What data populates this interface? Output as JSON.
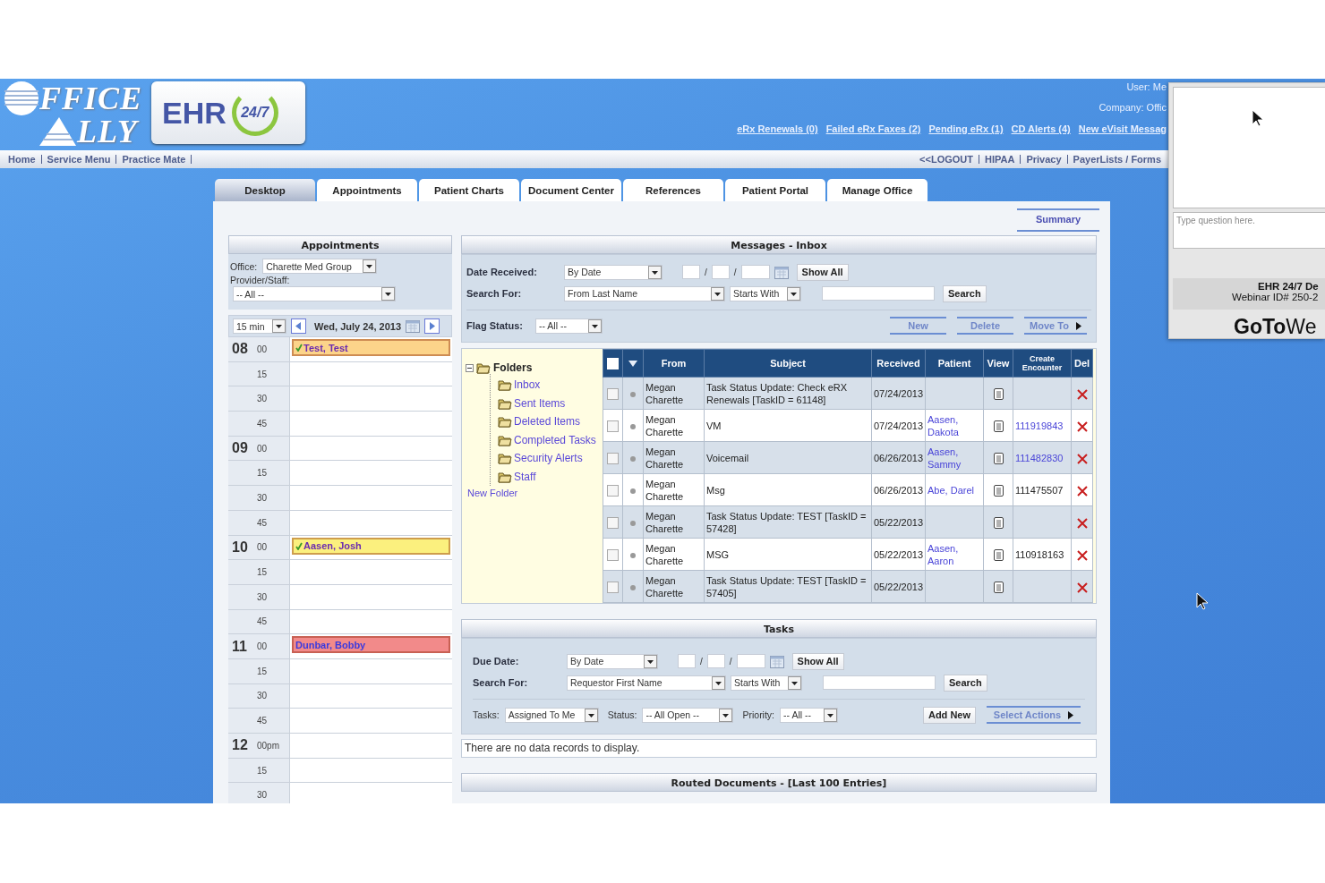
{
  "header": {
    "logo_line1": "FFICE",
    "logo_line2": "LLY",
    "badge_name": "EHR",
    "badge_tag": "24/7",
    "user": "User: Me",
    "company": "Company: Offic",
    "alert_links": [
      "eRx Renewals (0)",
      "Failed eRx Faxes (2)",
      "Pending eRx (1)",
      "CD Alerts (4)",
      "New eVisit Messag"
    ]
  },
  "nav": {
    "left": [
      "Home",
      "Service Menu",
      "Practice Mate"
    ],
    "right": [
      "<<LOGOUT",
      "HIPAA",
      "Privacy",
      "PayerLists / Forms"
    ]
  },
  "tabs": [
    {
      "label": "Desktop",
      "selected": true
    },
    {
      "label": "Appointments",
      "selected": false
    },
    {
      "label": "Patient Charts",
      "selected": false
    },
    {
      "label": "Document Center",
      "selected": false
    },
    {
      "label": "References",
      "selected": false
    },
    {
      "label": "Patient Portal",
      "selected": false
    },
    {
      "label": "Manage Office",
      "selected": false
    }
  ],
  "summary_link": "Summary",
  "appointments": {
    "title": "Appointments",
    "office_label": "Office:",
    "office": "Charette Med Group",
    "provider_label": "Provider/Staff:",
    "provider": "-- All --",
    "interval": "15 min",
    "date": "Wed, July 24, 2013",
    "hours": [
      {
        "hour": "08",
        "slots": [
          {
            "minute": "00",
            "appointment": {
              "patient": "Test, Test",
              "color": "#fcd48a",
              "confirmed": true
            }
          },
          {
            "minute": "15"
          },
          {
            "minute": "30"
          },
          {
            "minute": "45"
          }
        ]
      },
      {
        "hour": "09",
        "slots": [
          {
            "minute": "00"
          },
          {
            "minute": "15"
          },
          {
            "minute": "30"
          },
          {
            "minute": "45"
          }
        ]
      },
      {
        "hour": "10",
        "slots": [
          {
            "minute": "00",
            "appointment": {
              "patient": "Aasen, Josh",
              "color": "#fbf07e",
              "confirmed": true
            }
          },
          {
            "minute": "15"
          },
          {
            "minute": "30"
          },
          {
            "minute": "45"
          }
        ]
      },
      {
        "hour": "11",
        "slots": [
          {
            "minute": "00",
            "appointment": {
              "patient": "Dunbar, Bobby",
              "color": "#f28a8a",
              "confirmed": false
            }
          },
          {
            "minute": "15"
          },
          {
            "minute": "30"
          },
          {
            "minute": "45"
          }
        ]
      },
      {
        "hour": "12",
        "slots": [
          {
            "minute": "00pm"
          },
          {
            "minute": "15"
          },
          {
            "minute": "30"
          }
        ]
      }
    ]
  },
  "messages": {
    "title": "Messages - Inbox",
    "date_label": "Date Received:",
    "date_mode": "By Date",
    "date_separators": [
      "/",
      "/"
    ],
    "show_all": "Show All",
    "search_label": "Search For:",
    "search_field": "From Last Name",
    "search_match": "Starts With",
    "search_button": "Search",
    "flag_label": "Flag Status:",
    "flag_value": "-- All --",
    "actions": [
      "New",
      "Delete"
    ],
    "move_to": "Move To",
    "folders": {
      "label": "Folders",
      "expanded": true,
      "children": [
        "Inbox",
        "Sent Items",
        "Deleted Items",
        "Completed Tasks",
        "Security Alerts",
        "Staff"
      ]
    },
    "new_folder": "New Folder",
    "select_all_checked": false,
    "columns": [
      "From",
      "Subject",
      "Received",
      "Patient",
      "View",
      "Create Encounter",
      "Del"
    ],
    "rows": [
      {
        "checked": false,
        "from": "Megan Charette",
        "subject": "Task Status Update: Check eRX Renewals [TaskID = 61148]",
        "received": "07/24/2013"
      },
      {
        "checked": false,
        "from": "Megan Charette",
        "subject": "VM",
        "received": "07/24/2013",
        "patient": "Aasen, Dakota",
        "encounter": {
          "text": "111919843",
          "linked": true
        }
      },
      {
        "checked": false,
        "from": "Megan Charette",
        "subject": "Voicemail",
        "received": "06/26/2013",
        "patient": "Aasen, Sammy",
        "encounter": {
          "text": "111482830",
          "linked": true
        }
      },
      {
        "checked": false,
        "from": "Megan Charette",
        "subject": "Msg",
        "received": "06/26/2013",
        "patient": "Abe, Darel",
        "encounter": {
          "text": "111475507",
          "linked": false
        }
      },
      {
        "checked": false,
        "from": "Megan Charette",
        "subject": "Task Status Update: TEST [TaskID = 57428]",
        "received": "05/22/2013"
      },
      {
        "checked": false,
        "from": "Megan Charette",
        "subject": "MSG",
        "received": "05/22/2013",
        "patient": "Aasen, Aaron",
        "encounter": {
          "text": "110918163",
          "linked": false
        }
      },
      {
        "checked": false,
        "from": "Megan Charette",
        "subject": "Task Status Update: TEST [TaskID = 57405]",
        "received": "05/22/2013"
      }
    ]
  },
  "tasks": {
    "title": "Tasks",
    "date_label": "Due Date:",
    "date_mode": "By Date",
    "date_separators": [
      "/",
      "/"
    ],
    "show_all": "Show All",
    "search_label": "Search For:",
    "search_field": "Requestor First Name",
    "search_match": "Starts With",
    "search_button": "Search",
    "tasks_label": "Tasks:",
    "tasks_value": "Assigned To Me",
    "status_label": "Status:",
    "status_value": "-- All Open --",
    "priority_label": "Priority:",
    "priority_value": "-- All --",
    "add_new": "Add New",
    "select_actions": "Select Actions",
    "empty_message": "There are no data records to display."
  },
  "routed_documents": {
    "title": "Routed Documents - [Last 100 Entries]"
  },
  "webinar_panel": {
    "placeholder": "Type question here.",
    "title": "EHR 24/7 De",
    "webinar_id": "Webinar ID# 250-2",
    "brand_bold": "GoTo",
    "brand_light": "We"
  }
}
